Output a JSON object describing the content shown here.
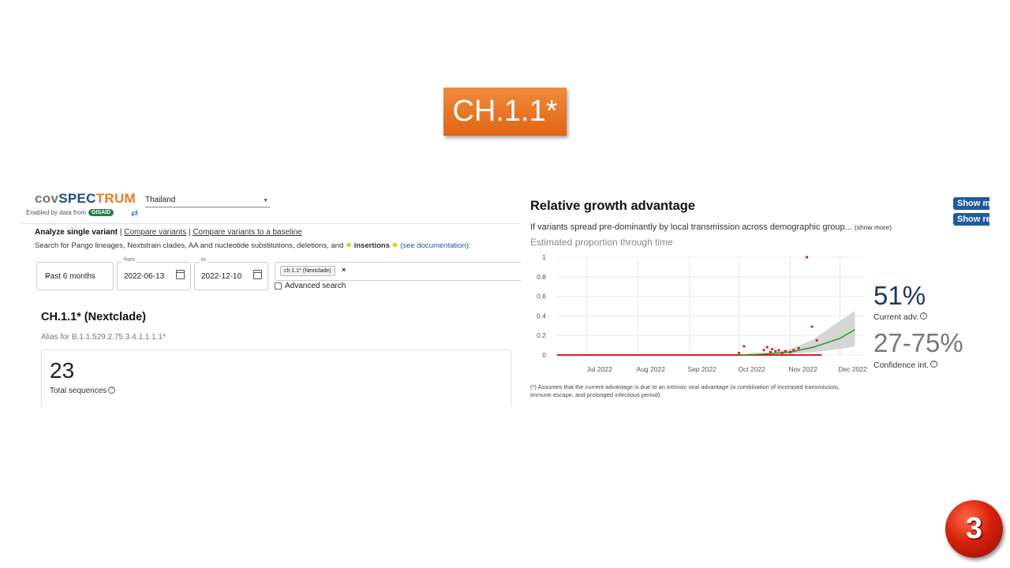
{
  "slide": {
    "title": "CH.1.1*",
    "page_number": "3"
  },
  "left_app": {
    "logo": {
      "cov": "cov",
      "spec": "SPEC",
      "trum": "TRUM"
    },
    "enabled_by": "Enabled by data from",
    "gisaid": "GISAID",
    "swap_icon": "⇄",
    "country": "Thailand",
    "nav": {
      "active": "Analyze single variant",
      "sep": "|",
      "compare": "Compare variants",
      "baseline": "Compare variants to a baseline"
    },
    "search_desc": "Search for Pango lineages, Nextstrain clades, AA and nucleotide substitutions, deletions, and",
    "search_insertions": "insertions",
    "search_doc": "(see documentation)",
    "period": {
      "value": "Past 6 months"
    },
    "from": {
      "label": "from",
      "value": "2022-06-13"
    },
    "to": {
      "label": "to",
      "value": "2022-12-10"
    },
    "query_chip": "ch.1.1* (Nextclade)",
    "advanced_search": "Advanced search",
    "variant_title": "CH.1.1* (Nextclade)",
    "alias": "Alias for B.1.1.529.2.75.3.4.1.1.1.1*",
    "total_count": "23",
    "total_label": "Total sequences"
  },
  "right_app": {
    "title": "Relative growth advantage",
    "show_more_btn": "Show more",
    "show_reset_btn": "Show re",
    "description": "If variants spread pre-dominantly by local transmission across demographic group...",
    "show_more_link": "(show more)",
    "subtitle": "Estimated proportion through time",
    "current_adv_value": "51%",
    "current_adv_label": "Current adv.",
    "conf_value": "27-75%",
    "conf_label": "Confidence int.",
    "footnote": "(*) Assumes that the current advantage is due to an intrinsic viral advantage (a combination of increased transmission, immune escape, and prolonged infectious period)."
  },
  "chart_data": {
    "type": "scatter",
    "title": "Estimated proportion through time",
    "x_tick_labels": [
      "Jul 2022",
      "Aug 2022",
      "Sep 2022",
      "Oct 2022",
      "Nov 2022",
      "Dec 2022"
    ],
    "y_tick_labels": [
      "0",
      "0.2",
      "0.4",
      "0.6",
      "0.8",
      "1"
    ],
    "ylim": [
      0,
      1
    ],
    "grid": true,
    "colors": {
      "points": "#d32222",
      "fit": "#2ca02c",
      "ci_band": "#cfcfcf"
    },
    "points": [
      {
        "x": "2022-10-01",
        "y": 0.02
      },
      {
        "x": "2022-10-04",
        "y": 0.09
      },
      {
        "x": "2022-10-16",
        "y": 0.05
      },
      {
        "x": "2022-10-18",
        "y": 0.08
      },
      {
        "x": "2022-10-20",
        "y": 0.03
      },
      {
        "x": "2022-10-21",
        "y": 0.06
      },
      {
        "x": "2022-10-23",
        "y": 0.04
      },
      {
        "x": "2022-10-25",
        "y": 0.05
      },
      {
        "x": "2022-10-27",
        "y": 0.02
      },
      {
        "x": "2022-10-29",
        "y": 0.04
      },
      {
        "x": "2022-11-01",
        "y": 0.03
      },
      {
        "x": "2022-11-03",
        "y": 0.05
      },
      {
        "x": "2022-11-06",
        "y": 0.07
      },
      {
        "x": "2022-11-11",
        "y": 1.0
      },
      {
        "x": "2022-11-14",
        "y": 0.29
      },
      {
        "x": "2022-11-17",
        "y": 0.15
      }
    ],
    "fit": [
      {
        "x": "2022-10-01",
        "y": 0.0
      },
      {
        "x": "2022-10-15",
        "y": 0.01
      },
      {
        "x": "2022-11-01",
        "y": 0.03
      },
      {
        "x": "2022-11-15",
        "y": 0.08
      },
      {
        "x": "2022-12-01",
        "y": 0.17
      },
      {
        "x": "2022-12-10",
        "y": 0.26
      }
    ],
    "ci_upper": [
      {
        "x": "2022-10-01",
        "y": 0.0
      },
      {
        "x": "2022-10-15",
        "y": 0.01
      },
      {
        "x": "2022-11-01",
        "y": 0.06
      },
      {
        "x": "2022-11-15",
        "y": 0.16
      },
      {
        "x": "2022-12-01",
        "y": 0.35
      },
      {
        "x": "2022-12-10",
        "y": 0.45
      }
    ],
    "ci_lower": [
      {
        "x": "2022-10-01",
        "y": 0.0
      },
      {
        "x": "2022-10-15",
        "y": 0.0
      },
      {
        "x": "2022-11-01",
        "y": 0.01
      },
      {
        "x": "2022-11-15",
        "y": 0.03
      },
      {
        "x": "2022-12-01",
        "y": 0.06
      },
      {
        "x": "2022-12-10",
        "y": 0.09
      }
    ]
  }
}
